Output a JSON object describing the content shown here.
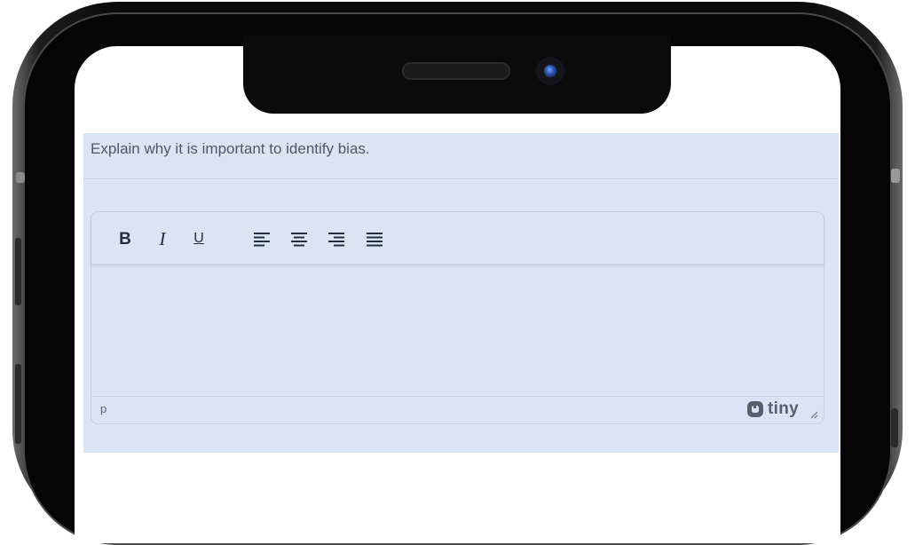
{
  "question": {
    "text": "Explain why it is important to identify bias."
  },
  "editor": {
    "toolbar": {
      "buttons": [
        {
          "name": "bold-button",
          "label": "B",
          "icon": "bold-icon"
        },
        {
          "name": "italic-button",
          "label": "I",
          "icon": "italic-icon"
        },
        {
          "name": "underline-button",
          "label": "U",
          "icon": "underline-icon"
        },
        {
          "name": "align-left-button",
          "icon": "align-left-icon"
        },
        {
          "name": "align-center-button",
          "icon": "align-center-icon"
        },
        {
          "name": "align-right-button",
          "icon": "align-right-icon"
        },
        {
          "name": "justify-button",
          "icon": "align-justify-icon"
        }
      ],
      "bold_label": "B",
      "italic_label": "I",
      "underline_label": "U"
    },
    "statusbar": {
      "element_path": "p",
      "brand": "tiny",
      "brand_icon": "tiny-logo-icon",
      "resize_icon": "resize-handle-icon"
    }
  },
  "colors": {
    "content_background": "#dbe4f4",
    "text": "#4e5769",
    "toolbar_icon": "#222f3e"
  }
}
